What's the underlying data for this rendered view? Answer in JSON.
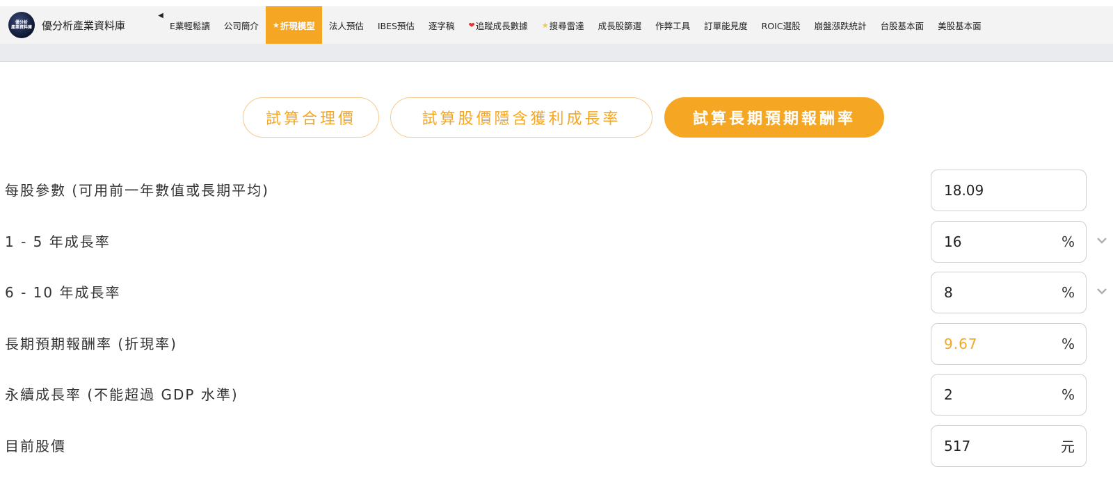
{
  "brand": {
    "logo_text": "優分析\n產業資料庫",
    "name": "優分析產業資料庫"
  },
  "nav": {
    "items": [
      {
        "label": "E業輕鬆讀",
        "icon": ""
      },
      {
        "label": "公司簡介",
        "icon": ""
      },
      {
        "label": "折現模型",
        "icon": "star-icon",
        "active": true
      },
      {
        "label": "法人預估",
        "icon": ""
      },
      {
        "label": "IBES預估",
        "icon": ""
      },
      {
        "label": "逐字稿",
        "icon": ""
      },
      {
        "label": "追蹤成長數據",
        "icon": "heart-icon"
      },
      {
        "label": "搜尋雷達",
        "icon": "star-icon"
      },
      {
        "label": "成長股篩選",
        "icon": ""
      },
      {
        "label": "作弊工具",
        "icon": ""
      },
      {
        "label": "訂單能見度",
        "icon": ""
      },
      {
        "label": "ROIC選股",
        "icon": ""
      },
      {
        "label": "崩盤漲跌統計",
        "icon": ""
      },
      {
        "label": "台股基本面",
        "icon": ""
      },
      {
        "label": "美股基本面",
        "icon": ""
      }
    ]
  },
  "modes": [
    {
      "label": "試算合理價",
      "active": false
    },
    {
      "label": "試算股價隱含獲利成長率",
      "active": false
    },
    {
      "label": "試算長期預期報酬率",
      "active": true
    }
  ],
  "form": {
    "rows": [
      {
        "label": "每股參數 (可用前一年數值或長期平均)",
        "value": "18.09",
        "unit": "",
        "dropdown": false,
        "accent": false
      },
      {
        "label": "1 - 5 年成長率",
        "value": "16",
        "unit": "%",
        "dropdown": true,
        "accent": false
      },
      {
        "label": "6 - 10 年成長率",
        "value": "8",
        "unit": "%",
        "dropdown": true,
        "accent": false
      },
      {
        "label": "長期預期報酬率 (折現率)",
        "value": "9.67",
        "unit": "%",
        "dropdown": false,
        "accent": true
      },
      {
        "label": "永續成長率 (不能超過 GDP 水準)",
        "value": "2",
        "unit": "%",
        "dropdown": false,
        "accent": false
      },
      {
        "label": "目前股價",
        "value": "517",
        "unit": "元",
        "dropdown": false,
        "accent": false
      }
    ]
  },
  "colors": {
    "accent": "#f5a623",
    "nav_bg": "#f3f3f3",
    "subbar_bg": "#e9ebee"
  }
}
